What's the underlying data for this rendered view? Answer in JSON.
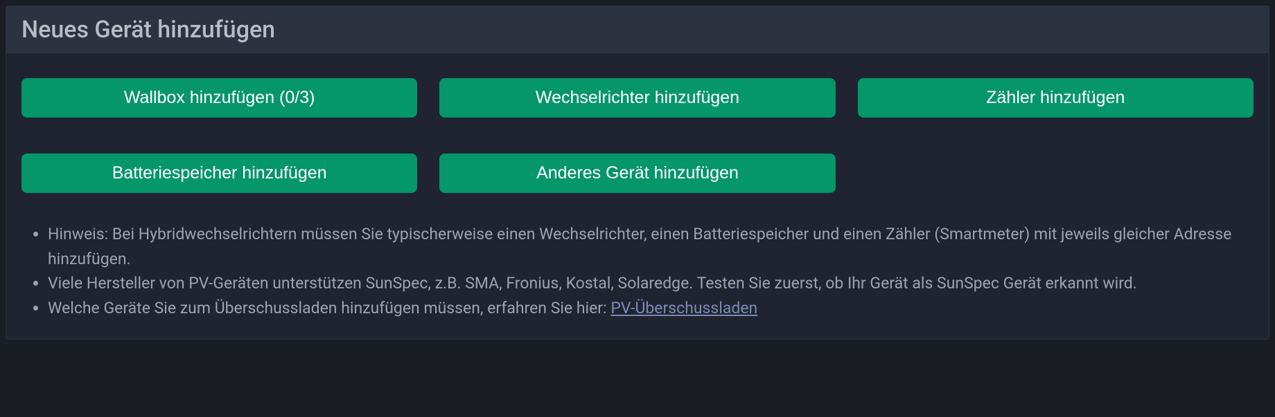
{
  "header": {
    "title": "Neues Gerät hinzufügen"
  },
  "buttons": {
    "wallbox": "Wallbox hinzufügen (0/3)",
    "inverter": "Wechselrichter hinzufügen",
    "meter": "Zähler hinzufügen",
    "battery": "Batteriespeicher hinzufügen",
    "other": "Anderes Gerät hinzufügen"
  },
  "hints": {
    "item1": "Hinweis: Bei Hybridwechselrichtern müssen Sie typischerweise einen Wechselrichter, einen Batteriespeicher und einen Zähler (Smartmeter) mit jeweils gleicher Adresse hinzufügen.",
    "item2": "Viele Hersteller von PV-Geräten unterstützen SunSpec, z.B. SMA, Fronius, Kostal, Solaredge. Testen Sie zuerst, ob Ihr Gerät als SunSpec Gerät erkannt wird.",
    "item3_prefix": "Welche Geräte Sie zum Überschussladen hinzufügen müssen, erfahren Sie hier: ",
    "item3_link": "PV-Überschussladen"
  }
}
